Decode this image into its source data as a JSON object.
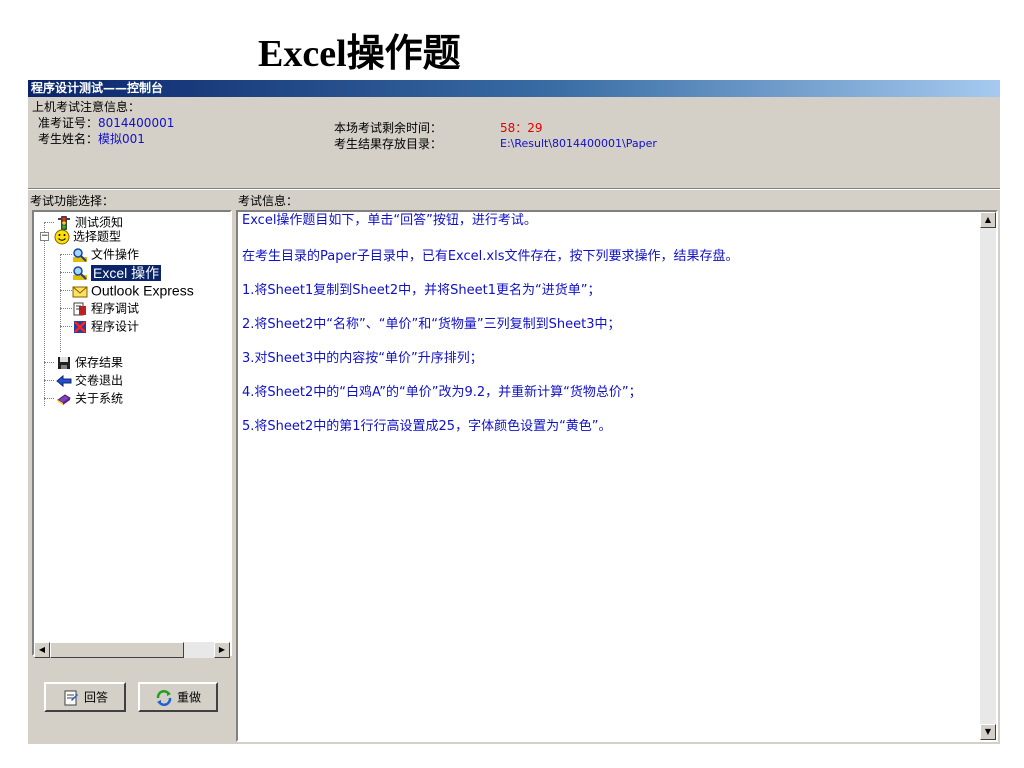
{
  "page_title": "Excel操作题",
  "window": {
    "title": "程序设计测试——控制台"
  },
  "notice": {
    "header": "上机考试注意信息：",
    "ticket_label": "准考证号：",
    "ticket_value": "8014400001",
    "name_label": "考生姓名：",
    "name_value": "模拟001",
    "time_label": "本场考试剩余时间：",
    "time_value": "58：29",
    "dir_label": "考生结果存放目录：",
    "dir_value": "E:\\Result\\8014400001\\Paper"
  },
  "sidebar": {
    "header": "考试功能选择：",
    "items": [
      {
        "label": "测试须知",
        "icon": "traffic-light-icon"
      },
      {
        "label": "选择题型",
        "icon": "smiley-icon"
      },
      {
        "label": "文件操作",
        "icon": "magnifier-icon"
      },
      {
        "label": "Excel 操作",
        "icon": "magnifier-icon",
        "selected": true
      },
      {
        "label": "Outlook Express",
        "icon": "mail-icon"
      },
      {
        "label": "程序调试",
        "icon": "debug-icon"
      },
      {
        "label": "程序设计",
        "icon": "design-icon"
      },
      {
        "label": "保存结果",
        "icon": "floppy-disk-icon"
      },
      {
        "label": "交卷退出",
        "icon": "exit-arrow-icon"
      },
      {
        "label": "关于系统",
        "icon": "book-icon"
      }
    ],
    "answer_button": "回答",
    "redo_button": "重做"
  },
  "content": {
    "header": "考试信息：",
    "lines": [
      "Excel操作题目如下，单击“回答”按钮，进行考试。",
      "在考生目录的Paper子目录中，已有Excel.xls文件存在，按下列要求操作，结果存盘。",
      "1.将Sheet1复制到Sheet2中，并将Sheet1更名为“进货单”；",
      "2.将Sheet2中“名称”、“单价”和“货物量”三列复制到Sheet3中；",
      "3.对Sheet3中的内容按“单价”升序排列；",
      "4.将Sheet2中的“白鸡A”的“单价”改为9.2，并重新计算“货物总价”；",
      "5.将Sheet2中的第1行行高设置成25，字体颜色设置为“黄色”。"
    ]
  },
  "colors": {
    "title_bar": "#0a246a",
    "text_blue": "#1010c8",
    "text_red": "#e00000",
    "selection": "#0a246a",
    "face": "#d4d0c8"
  }
}
